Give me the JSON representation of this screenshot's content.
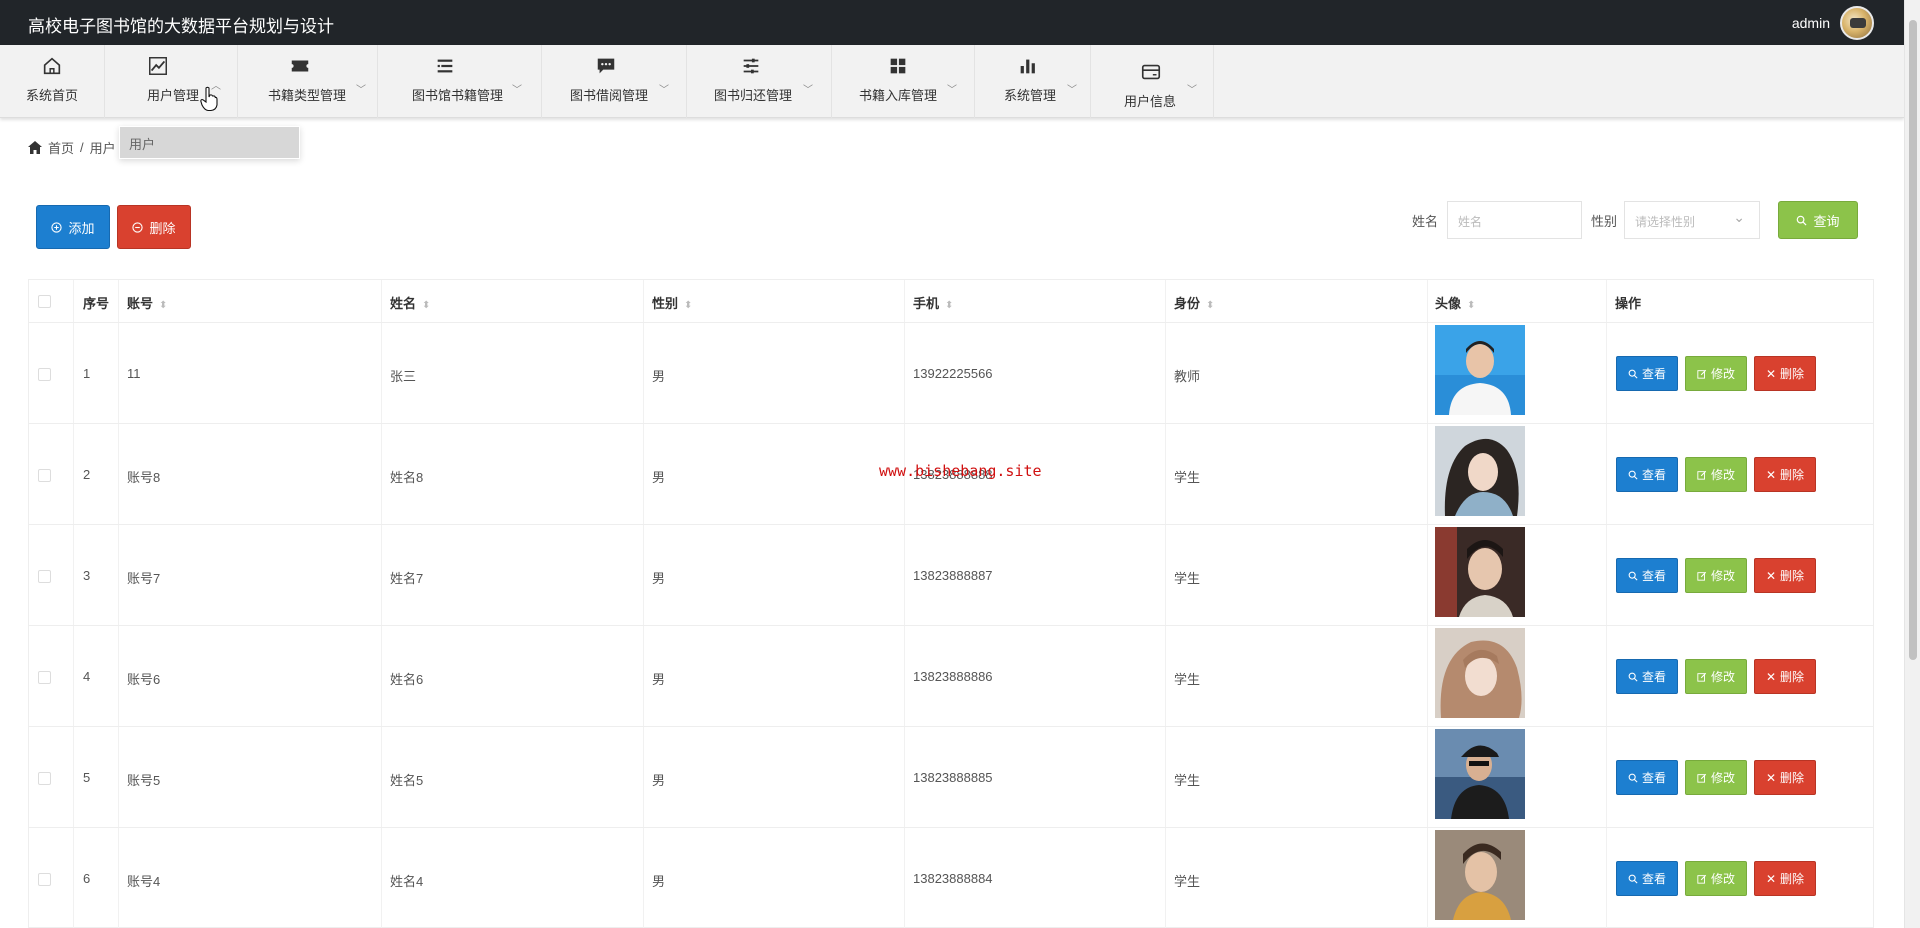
{
  "app": {
    "title": "高校电子图书馆的大数据平台规划与设计"
  },
  "user": {
    "name": "admin"
  },
  "nav": [
    {
      "label": "系统首页",
      "icon": "home-icon",
      "dropdown": false
    },
    {
      "label": "用户管理",
      "icon": "line-chart-icon",
      "dropdown": true
    },
    {
      "label": "书籍类型管理",
      "icon": "ticket-icon",
      "dropdown": true
    },
    {
      "label": "图书馆书籍管理",
      "icon": "list-icon",
      "dropdown": true
    },
    {
      "label": "图书借阅管理",
      "icon": "comment-icon",
      "dropdown": true
    },
    {
      "label": "图书归还管理",
      "icon": "sliders-icon",
      "dropdown": true
    },
    {
      "label": "书籍入库管理",
      "icon": "grid-icon",
      "dropdown": true
    },
    {
      "label": "系统管理",
      "icon": "bar-chart-icon",
      "dropdown": true
    },
    {
      "label": "用户信息",
      "icon": "card-icon",
      "dropdown": true
    }
  ],
  "submenu": {
    "item": "用户"
  },
  "breadcrumb": {
    "home": "首页",
    "sep": "/",
    "current": "用户"
  },
  "actions": {
    "add": "添加",
    "delete": "删除",
    "search": "查询"
  },
  "filters": {
    "name_label": "姓名",
    "name_placeholder": "姓名",
    "sex_label": "性别",
    "sex_placeholder": "请选择性别"
  },
  "table": {
    "headers": [
      "序号",
      "账号",
      "姓名",
      "性别",
      "手机",
      "身份",
      "头像",
      "操作"
    ],
    "rows": [
      {
        "no": "1",
        "account": "11",
        "name": "张三",
        "sex": "男",
        "phone": "13922225566",
        "role": "教师"
      },
      {
        "no": "2",
        "account": "账号8",
        "name": "姓名8",
        "sex": "男",
        "phone": "13823888888",
        "role": "学生"
      },
      {
        "no": "3",
        "account": "账号7",
        "name": "姓名7",
        "sex": "男",
        "phone": "13823888887",
        "role": "学生"
      },
      {
        "no": "4",
        "account": "账号6",
        "name": "姓名6",
        "sex": "男",
        "phone": "13823888886",
        "role": "学生"
      },
      {
        "no": "5",
        "account": "账号5",
        "name": "姓名5",
        "sex": "男",
        "phone": "13823888885",
        "role": "学生"
      },
      {
        "no": "6",
        "account": "账号4",
        "name": "姓名4",
        "sex": "男",
        "phone": "13823888884",
        "role": "学生"
      }
    ],
    "row_actions": {
      "view": "查看",
      "edit": "修改",
      "delete": "删除"
    }
  },
  "watermark": "www.bishebang.site",
  "colors": {
    "primary": "#1d7fd0",
    "success": "#8cc34a",
    "danger": "#d9412f",
    "topbar": "#212529"
  }
}
